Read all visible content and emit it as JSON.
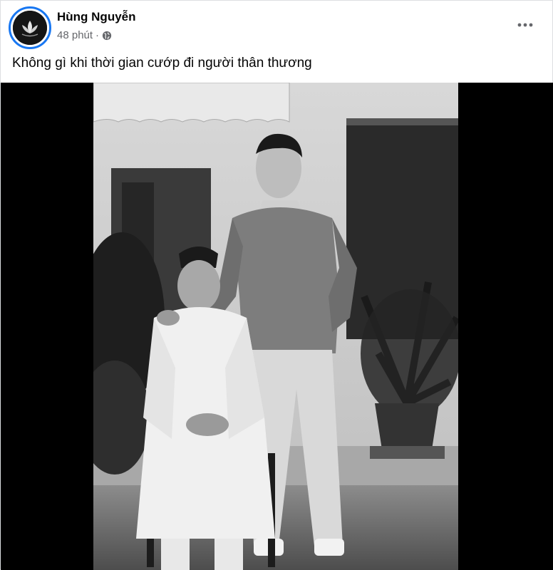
{
  "post": {
    "author": "Hùng Nguyễn",
    "time": "48 phút",
    "separator": "·",
    "privacy_icon": "globe-icon",
    "more_icon": "more-options-icon",
    "caption": "Không gì khi thời gian cướp đi người thân thương"
  },
  "colors": {
    "avatar_ring": "#1877f2",
    "name": "#050505",
    "meta": "#65676b",
    "photo_bg": "#000000"
  }
}
